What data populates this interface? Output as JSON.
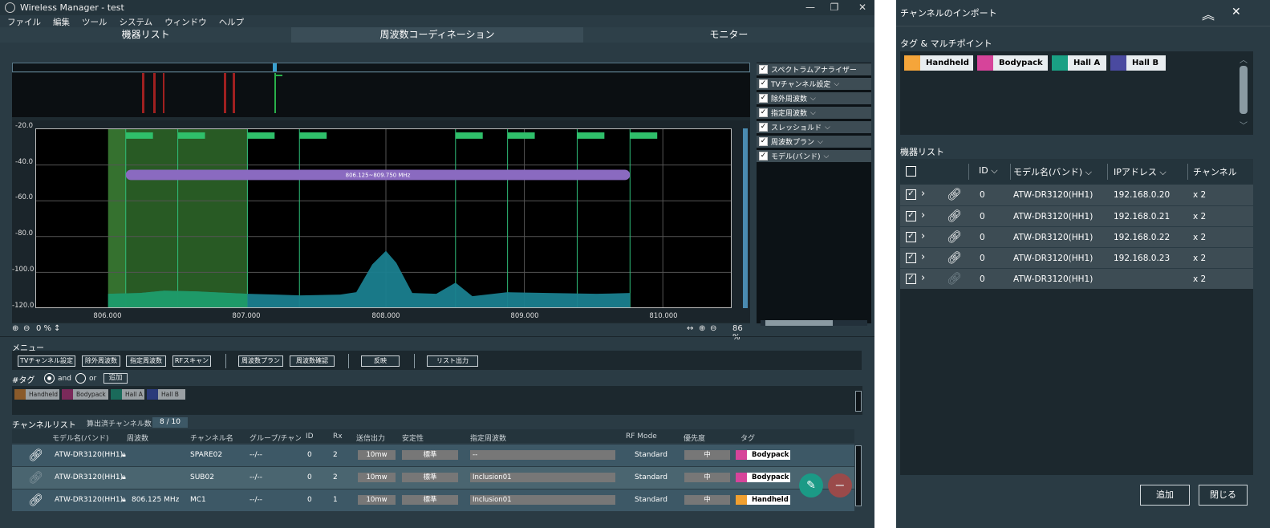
{
  "main": {
    "title": "Wireless Manager - test",
    "menu": [
      "ファイル",
      "編集",
      "ツール",
      "システム",
      "ウィンドウ",
      "ヘルプ"
    ],
    "tabs": [
      "機器リスト",
      "周波数コーディネーション",
      "モニター"
    ],
    "spectrum": {
      "y_ticks": [
        "-20.0",
        "-40.0",
        "-60.0",
        "-80.0",
        "-100.0",
        "-120.0"
      ],
      "x_ticks": [
        "806.000",
        "807.000",
        "808.000",
        "809.000",
        "810.000"
      ],
      "range_label": "806.125~809.750 MHz",
      "zoom_left": "0 %",
      "zoom_right": "86 %"
    },
    "right_options": [
      {
        "label": "スペクトラムアナライザー",
        "chevron": false
      },
      {
        "label": "TVチャンネル設定",
        "chevron": true
      },
      {
        "label": "除外周波数",
        "chevron": true
      },
      {
        "label": "指定周波数",
        "chevron": true
      },
      {
        "label": "スレッショルド",
        "chevron": true
      },
      {
        "label": "周波数プラン",
        "chevron": true
      },
      {
        "label": "モデル(バンド)",
        "chevron": true
      }
    ],
    "menu_label": "メニュー",
    "menu_buttons": [
      "TVチャンネル設定",
      "除外周波数",
      "指定周波数",
      "RFスキャン",
      "周波数プラン",
      "周波数確認",
      "反映",
      "リスト出力"
    ],
    "tag_label": "#タグ",
    "and_label": "and",
    "or_label": "or",
    "add_label": "追加",
    "tags": [
      {
        "name": "Handheld",
        "color": "#8a5a2a"
      },
      {
        "name": "Bodypack",
        "color": "#7a2a5a"
      },
      {
        "name": "Hall A",
        "color": "#1a6a5a"
      },
      {
        "name": "Hall B",
        "color": "#2a3a7a"
      }
    ],
    "channel_list_label": "チャンネルリスト",
    "calc_label": "算出済チャンネル数",
    "calc_value": "8 / 10",
    "columns": [
      "モデル名(バンド)",
      "周波数",
      "チャンネル名",
      "グループ/チャンネル",
      "ID",
      "Rx",
      "送信出力",
      "安定性",
      "指定周波数",
      "RF Mode",
      "優先度",
      "タグ"
    ],
    "rows": [
      {
        "model": "ATW-DR3120(HH1)",
        "freq": "",
        "name": "SPARE02",
        "group": "--/--",
        "id": "0",
        "rx": "2",
        "power": "10mw",
        "stability": "標準",
        "fixed": "--",
        "rfmode": "Standard",
        "priority": "中",
        "tag": "Bodypack",
        "tagcolor": "#d6449a"
      },
      {
        "model": "ATW-DR3120(HH1)",
        "freq": "",
        "name": "SUB02",
        "group": "--/--",
        "id": "0",
        "rx": "2",
        "power": "10mw",
        "stability": "標準",
        "fixed": "Inclusion01",
        "rfmode": "Standard",
        "priority": "中",
        "tag": "Bodypack",
        "tagcolor": "#d6449a"
      },
      {
        "model": "ATW-DR3120(HH1)",
        "freq": "806.125 MHz",
        "name": "MC1",
        "group": "--/--",
        "id": "0",
        "rx": "1",
        "power": "10mw",
        "stability": "標準",
        "fixed": "Inclusion01",
        "rfmode": "Standard",
        "priority": "中",
        "tag": "Handheld",
        "tagcolor": "#f0a030"
      }
    ]
  },
  "dialog": {
    "title": "チャンネルのインポート",
    "tag_section": "タグ & マルチポイント",
    "tags": [
      {
        "name": "Handheld",
        "color": "#f5a53a"
      },
      {
        "name": "Bodypack",
        "color": "#d6449a"
      },
      {
        "name": "Hall A",
        "color": "#1aa084"
      },
      {
        "name": "Hall B",
        "color": "#4a4aa0"
      }
    ],
    "device_section": "機器リスト",
    "columns": [
      "ID",
      "モデル名(バンド)",
      "IPアドレス",
      "チャンネル"
    ],
    "rows": [
      {
        "id": "0",
        "model": "ATW-DR3120(HH1)",
        "ip": "192.168.0.20",
        "ch": "x 2",
        "linked": true
      },
      {
        "id": "0",
        "model": "ATW-DR3120(HH1)",
        "ip": "192.168.0.21",
        "ch": "x 2",
        "linked": true
      },
      {
        "id": "0",
        "model": "ATW-DR3120(HH1)",
        "ip": "192.168.0.22",
        "ch": "x 2",
        "linked": true
      },
      {
        "id": "0",
        "model": "ATW-DR3120(HH1)",
        "ip": "192.168.0.23",
        "ch": "x 2",
        "linked": true
      },
      {
        "id": "0",
        "model": "ATW-DR3120(HH1)",
        "ip": "",
        "ch": "x 2",
        "linked": false
      }
    ],
    "add_button": "追加",
    "close_button": "閉じる"
  }
}
